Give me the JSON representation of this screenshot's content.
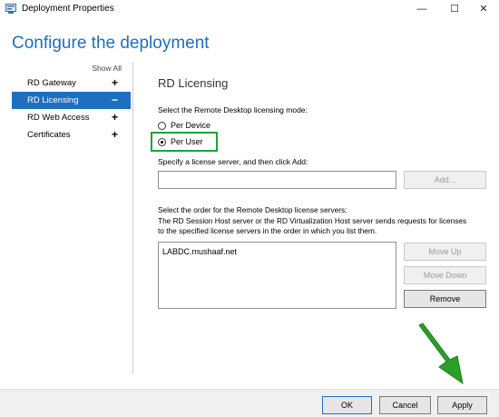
{
  "window": {
    "title": "Deployment Properties",
    "controls": {
      "minimize": "—",
      "maximize": "☐",
      "close": "✕"
    }
  },
  "heading": "Configure the deployment",
  "sidebar": {
    "show_all": "Show All",
    "items": [
      {
        "label": "RD Gateway",
        "sign": "+",
        "active": false
      },
      {
        "label": "RD Licensing",
        "sign": "−",
        "active": true
      },
      {
        "label": "RD Web Access",
        "sign": "+",
        "active": false
      },
      {
        "label": "Certificates",
        "sign": "+",
        "active": false
      }
    ]
  },
  "licensing": {
    "section_title": "RD Licensing",
    "mode_label": "Select the Remote Desktop licensing mode:",
    "modes": [
      {
        "label": "Per Device",
        "selected": false
      },
      {
        "label": "Per User",
        "selected": true
      }
    ],
    "specify_label": "Specify a license server, and then click Add:",
    "server_input_value": "",
    "add_label": "Add...",
    "order_text": [
      "Select the order for the Remote Desktop license servers:",
      "The RD Session Host server or the RD Virtualization Host server sends requests for licenses",
      "to the specified license servers in the order in which you list them."
    ],
    "servers": [
      "LABDC.mushaaf.net"
    ],
    "move_up_label": "Move Up",
    "move_down_label": "Move Down",
    "remove_label": "Remove"
  },
  "footer": {
    "ok_label": "OK",
    "cancel_label": "Cancel",
    "apply_label": "Apply"
  },
  "colors": {
    "accent_blue": "#1f6fc0",
    "heading_blue": "#1e6fbe",
    "highlight_green": "#1aa33a",
    "arrow_green": "#2aa02a"
  },
  "icons": {
    "app": "server-properties-icon",
    "arrow": "green-pointer-arrow"
  }
}
